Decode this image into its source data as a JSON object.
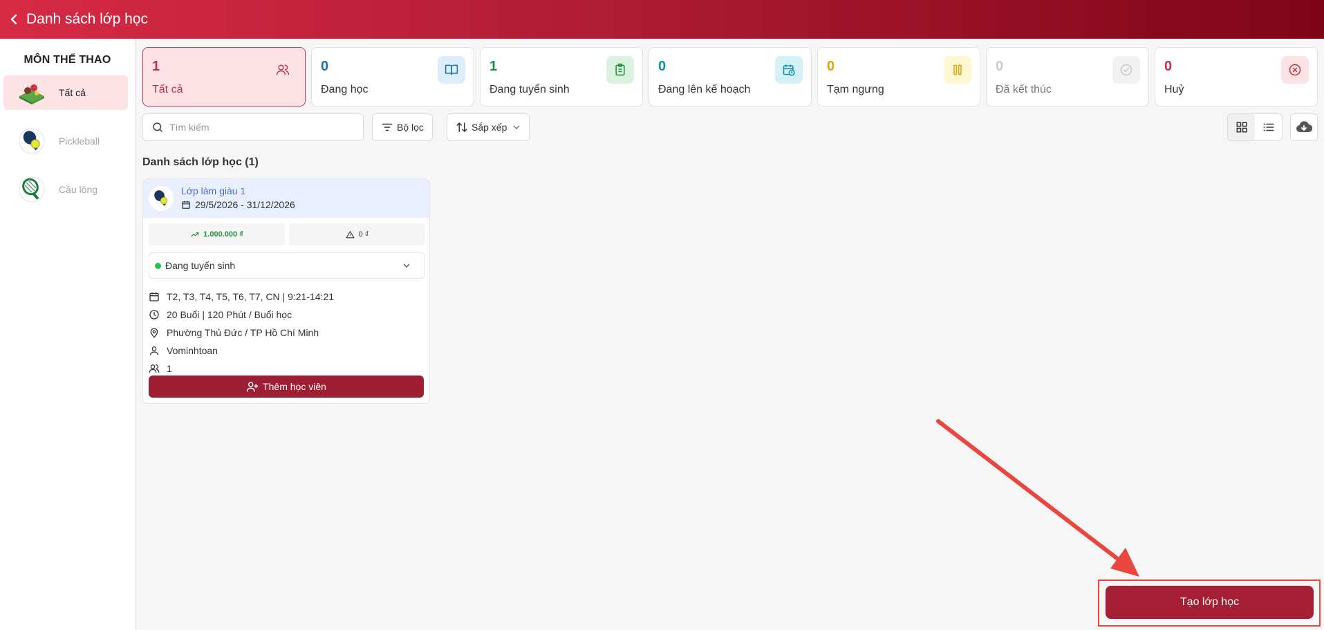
{
  "header": {
    "title": "Danh sách lớp học"
  },
  "sidebar": {
    "heading": "MÔN THỂ THAO",
    "items": [
      {
        "label": "Tất cả",
        "icon": "sports-field-icon",
        "active": true
      },
      {
        "label": "Pickleball",
        "icon": "pickleball-icon",
        "active": false
      },
      {
        "label": "Cầu lông",
        "icon": "badminton-icon",
        "active": false
      }
    ]
  },
  "stats": [
    {
      "count": "1",
      "label": "Tất cả",
      "icon": "users-icon",
      "color": "#c23247"
    },
    {
      "count": "0",
      "label": "Đang học",
      "icon": "book-icon",
      "color": "#1f6fb2"
    },
    {
      "count": "1",
      "label": "Đang tuyển sinh",
      "icon": "clipboard-icon",
      "color": "#1e8e3e"
    },
    {
      "count": "0",
      "label": "Đang lên kế hoạch",
      "icon": "calendar-clock-icon",
      "color": "#0c8fa8"
    },
    {
      "count": "0",
      "label": "Tạm ngưng",
      "icon": "pause-icon",
      "color": "#e3a300"
    },
    {
      "count": "0",
      "label": "Đã kết thúc",
      "icon": "check-circle-icon",
      "color": "#cccccc"
    },
    {
      "count": "0",
      "label": "Huỷ",
      "icon": "x-circle-icon",
      "color": "#c23247"
    }
  ],
  "toolbar": {
    "search_placeholder": "Tìm kiếm",
    "filter_label": "Bộ lọc",
    "sort_label": "Sắp xếp"
  },
  "list": {
    "heading": "Danh sách lớp học (1)",
    "classes": [
      {
        "title": "Lớp làm giàu 1",
        "date_range": "29/5/2026 - 31/12/2026",
        "revenue": "1.000.000 ₫",
        "debt": "0 ₫",
        "status": "Đang tuyển sinh",
        "schedule": "T2, T3, T4, T5, T6, T7, CN | 9:21-14:21",
        "sessions": "20 Buổi | 120 Phút / Buổi học",
        "location": "Phường Thủ Đức / TP Hồ Chí Minh",
        "teacher": "Vominhtoan",
        "students": "1",
        "add_student_label": "Thêm học viên"
      }
    ]
  },
  "create_button": {
    "label": "Tạo lớp học"
  },
  "colors": {
    "brand": "#a41f33",
    "header_start": "#d72a45",
    "header_end": "#7e0516",
    "annotation": "#e8463f"
  }
}
